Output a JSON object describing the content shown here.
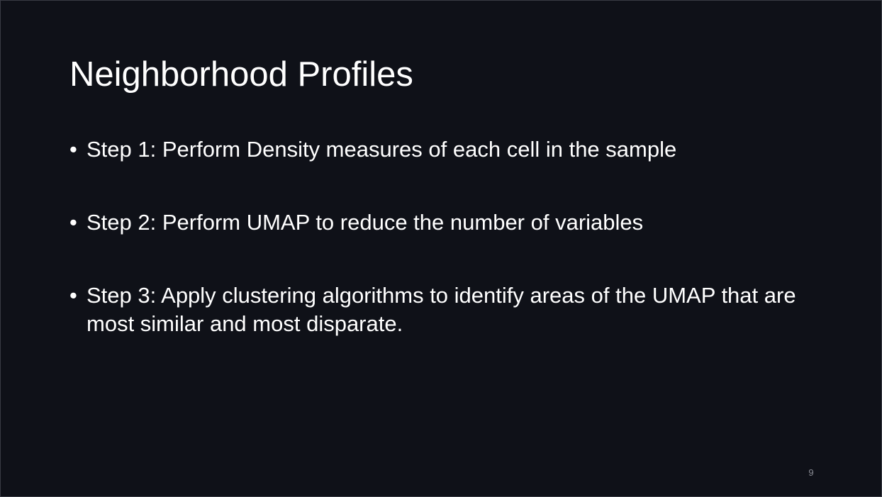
{
  "slide": {
    "title": "Neighborhood Profiles",
    "bullets": [
      {
        "marker": "•",
        "text": "Step 1: Perform Density measures of each cell in the sample"
      },
      {
        "marker": "•",
        "text": "Step 2: Perform UMAP to reduce the number of variables"
      },
      {
        "marker": "•",
        "text": "Step 3: Apply clustering algorithms to identify areas of the UMAP that are most similar and most disparate."
      }
    ],
    "page_number": "9"
  },
  "colors": {
    "background": "#0f1118",
    "text": "#ffffff",
    "page_number": "#8a8c94"
  }
}
